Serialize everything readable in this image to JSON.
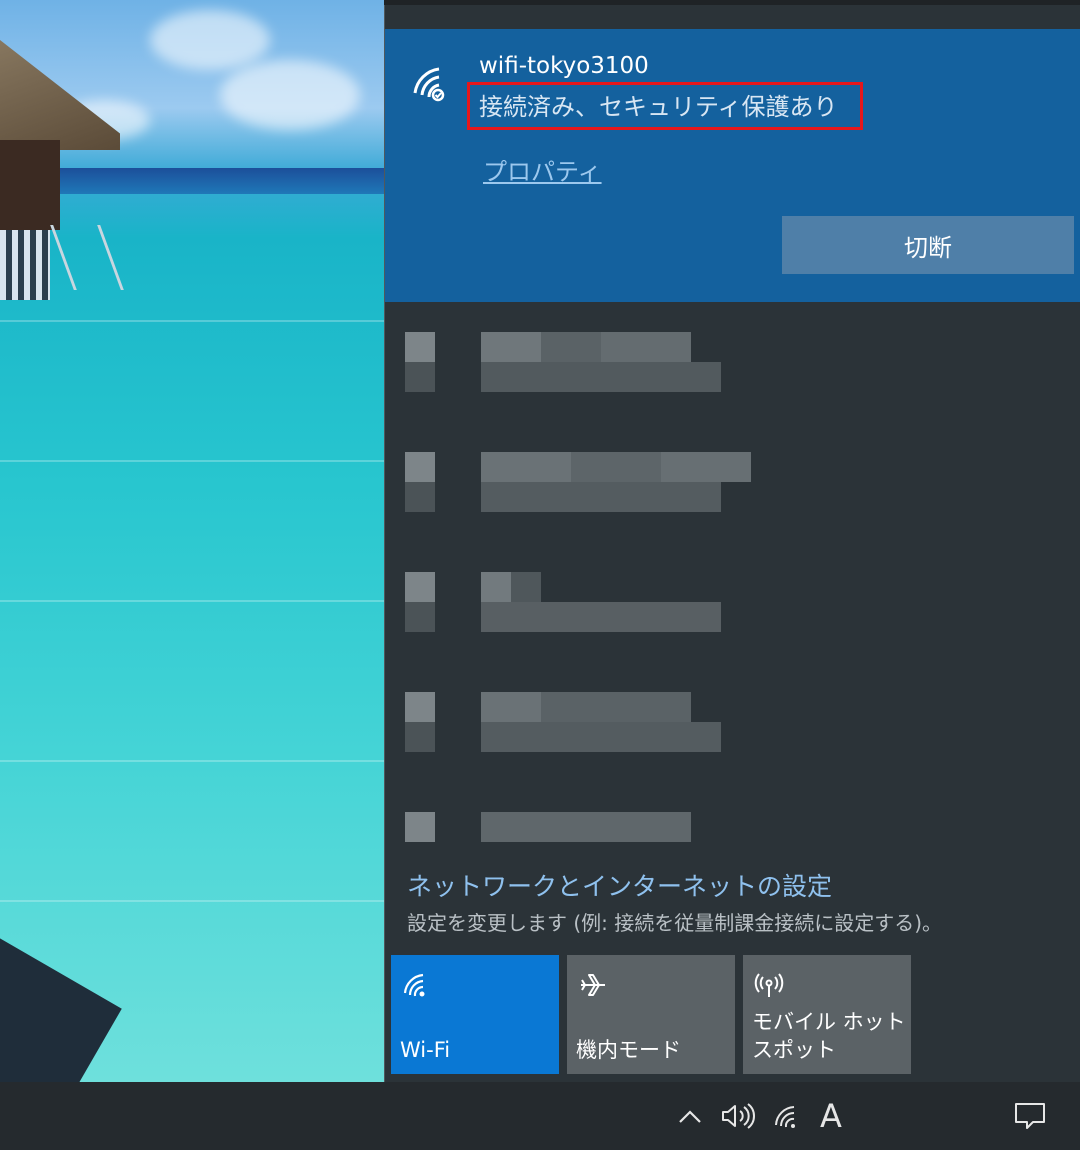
{
  "desktop": {
    "wallpaper": "tropical-beach-wallpaper"
  },
  "network_flyout": {
    "connected_network": {
      "icon": "wifi-signal-icon",
      "ssid": "wifi-tokyo3100",
      "status": "接続済み、セキュリティ保護あり",
      "properties_label": "プロパティ",
      "disconnect_label": "切断"
    },
    "other_networks_redacted": true,
    "settings": {
      "title": "ネットワークとインターネットの設定",
      "description": "設定を変更します (例: 接続を従量制課金接続に設定する)。"
    },
    "quick_actions": [
      {
        "label": "Wi-Fi",
        "icon": "wifi-icon",
        "active": true
      },
      {
        "label": "機内モード",
        "icon": "airplane-icon",
        "active": false
      },
      {
        "label": "モバイル ホットスポット",
        "icon": "hotspot-icon",
        "active": false
      }
    ]
  },
  "taskbar": {
    "tray": {
      "overflow_icon": "chevron-up-icon",
      "volume_icon": "speaker-icon",
      "network_icon": "wifi-icon",
      "ime_indicator": "A",
      "notifications_icon": "action-center-icon"
    }
  },
  "colors": {
    "accent": "#0a78d4",
    "connected_bg": "#14619e",
    "flyout_bg": "#2b3338",
    "highlight_box": "#e5171c"
  }
}
